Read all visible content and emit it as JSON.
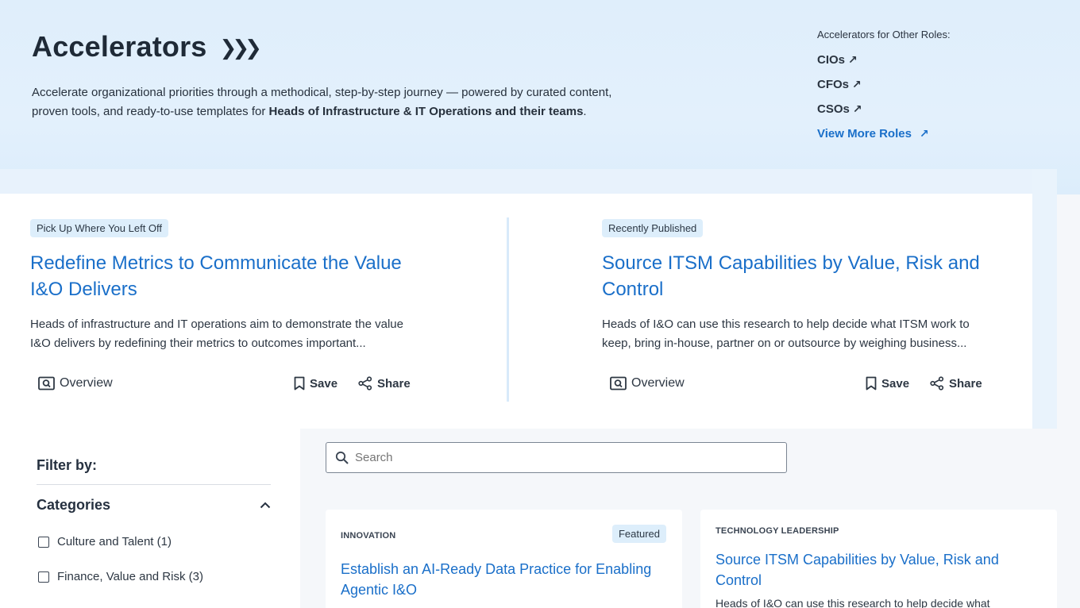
{
  "hero": {
    "title": "Accelerators",
    "chevrons": "❯❯❯",
    "desc_plain": "Accelerate organizational priorities through a methodical, step-by-step journey — powered by curated content, proven tools, and ready-to-use templates for ",
    "desc_bold": "Heads of Infrastructure & IT Operations and their teams",
    "desc_end": "."
  },
  "roles": {
    "label": "Accelerators for Other Roles:",
    "items": [
      {
        "label": "CIOs"
      },
      {
        "label": "CFOs"
      },
      {
        "label": "CSOs"
      }
    ],
    "more_label": "View More Roles"
  },
  "featured": [
    {
      "tag": "Pick Up Where You Left Off",
      "title": "Redefine Metrics to Communicate the Value I&O Delivers",
      "desc": "Heads of infrastructure and IT operations aim to demonstrate the value I&O delivers by redefining their metrics to outcomes important...",
      "overview": "Overview",
      "save": "Save",
      "share": "Share"
    },
    {
      "tag": "Recently Published",
      "title": "Source ITSM Capabilities by Value, Risk and Control",
      "desc": "Heads of I&O can use this research to help decide what ITSM work to keep, bring in-house, partner on or outsource by weighing business...",
      "overview": "Overview",
      "save": "Save",
      "share": "Share"
    }
  ],
  "filter": {
    "title": "Filter by:",
    "categories_title": "Categories",
    "options": [
      {
        "label": "Culture and Talent (1)",
        "checked": false
      },
      {
        "label": "Finance, Value and Risk (3)",
        "checked": false
      }
    ]
  },
  "search": {
    "placeholder": "Search"
  },
  "results": [
    {
      "category": "INNOVATION",
      "badge": "Featured",
      "title": "Establish an AI-Ready Data Practice for Enabling Agentic I&O"
    },
    {
      "category": "TECHNOLOGY LEADERSHIP",
      "title": "Source ITSM Capabilities by Value, Risk and Control",
      "desc": "Heads of I&O can use this research to help decide what"
    }
  ],
  "colors": {
    "accent": "#1a6fc9",
    "hero_bg": "#dfeefb",
    "tag_bg": "#ddeefb"
  }
}
